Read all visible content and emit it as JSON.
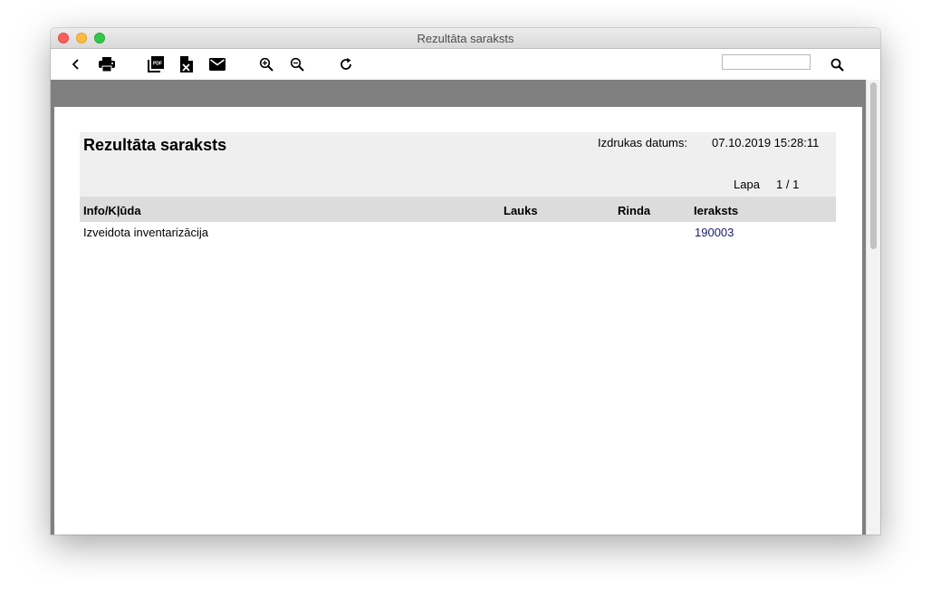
{
  "window": {
    "title": "Rezultāta saraksts"
  },
  "toolbar": {
    "icons": [
      "back-icon",
      "print-icon",
      "pdf-icon",
      "excel-icon",
      "mail-icon",
      "zoom-in-icon",
      "zoom-out-icon",
      "refresh-icon",
      "search-icon"
    ],
    "search": {
      "value": "",
      "placeholder": ""
    }
  },
  "report": {
    "title": "Rezultāta saraksts",
    "date_label": "Izdrukas datums:",
    "date_value": "07.10.2019 15:28:11",
    "page_label": "Lapa",
    "page_value": "1 / 1",
    "columns": [
      "Info/Kļūda",
      "Lauks",
      "Rinda",
      "Ieraksts"
    ],
    "rows": [
      {
        "info": "Izveidota inventarizācija",
        "field": "",
        "row": "",
        "record": "190003"
      }
    ]
  },
  "colors": {
    "gray_band": "#808080",
    "header_band": "#efefef",
    "column_band": "#dcdcdc",
    "link": "#1a1a6e"
  }
}
